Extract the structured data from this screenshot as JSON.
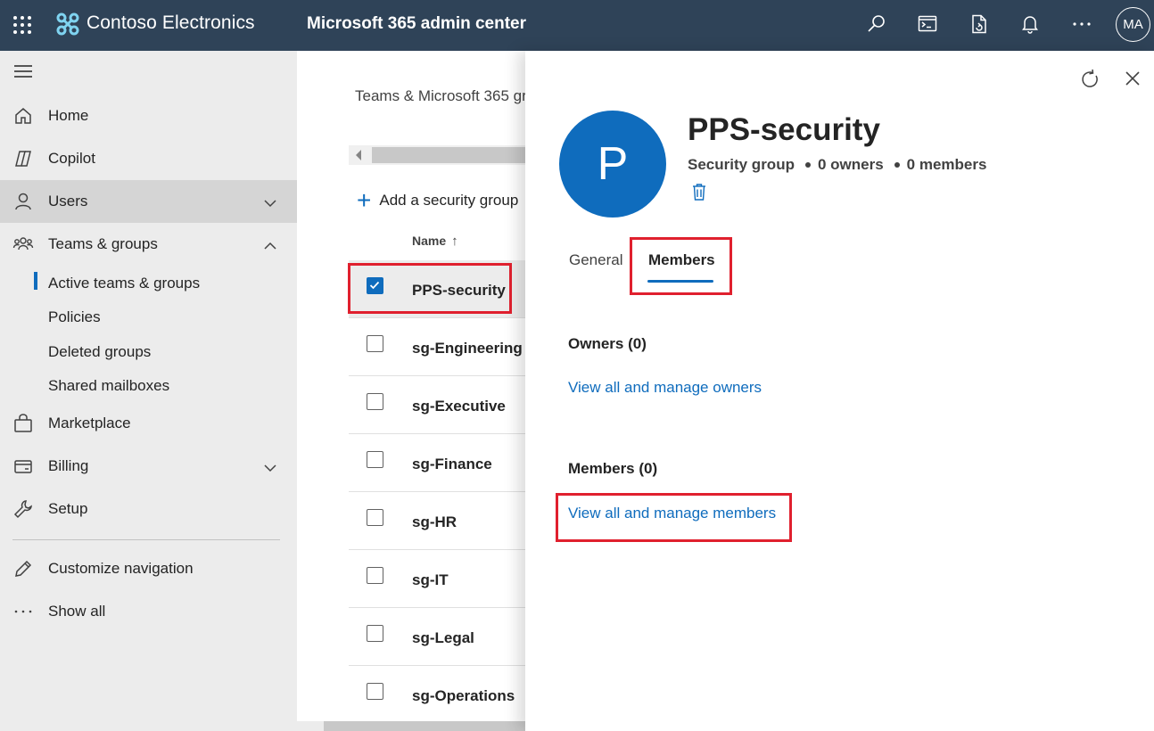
{
  "topbar": {
    "org_name": "Contoso Electronics",
    "app_title": "Microsoft 365 admin center",
    "avatar_initials": "MA",
    "colors": {
      "background": "#2f4358"
    }
  },
  "leftnav": {
    "items": [
      {
        "label": "Home",
        "icon": "home-icon"
      },
      {
        "label": "Copilot",
        "icon": "copilot-icon"
      },
      {
        "label": "Users",
        "icon": "user-icon",
        "expandable": true,
        "selected": true
      },
      {
        "label": "Teams & groups",
        "icon": "teams-groups-icon",
        "expanded": true
      },
      {
        "label": "Marketplace",
        "icon": "shopping-bag-icon"
      },
      {
        "label": "Billing",
        "icon": "billing-card-icon",
        "expandable": true
      },
      {
        "label": "Setup",
        "icon": "wrench-icon"
      },
      {
        "label": "Customize navigation",
        "icon": "pencil-icon"
      },
      {
        "label": "Show all",
        "icon": "more-icon"
      }
    ],
    "sub_items": [
      {
        "label": "Active teams & groups",
        "active": true
      },
      {
        "label": "Policies"
      },
      {
        "label": "Deleted groups"
      },
      {
        "label": "Shared mailboxes"
      }
    ]
  },
  "main": {
    "breadcrumb": "Teams & Microsoft 365 gr",
    "add_button": "Add a security group",
    "column_name": "Name",
    "rows": [
      {
        "name": "PPS-security",
        "checked": true
      },
      {
        "name": "sg-Engineering",
        "checked": false
      },
      {
        "name": "sg-Executive",
        "checked": false
      },
      {
        "name": "sg-Finance",
        "checked": false
      },
      {
        "name": "sg-HR",
        "checked": false
      },
      {
        "name": "sg-IT",
        "checked": false
      },
      {
        "name": "sg-Legal",
        "checked": false
      },
      {
        "name": "sg-Operations",
        "checked": false
      }
    ]
  },
  "panel": {
    "avatar_letter": "P",
    "title": "PPS-security",
    "group_type": "Security group",
    "owners_count": "0 owners",
    "members_count": "0 members",
    "tabs": [
      {
        "label": "General",
        "active": false
      },
      {
        "label": "Members",
        "active": true
      }
    ],
    "owners_heading": "Owners (0)",
    "owners_link": "View all and manage owners",
    "members_heading": "Members (0)",
    "members_link": "View all and manage members",
    "colors": {
      "accent": "#0f6cbd",
      "highlight": "#e0202e"
    }
  }
}
